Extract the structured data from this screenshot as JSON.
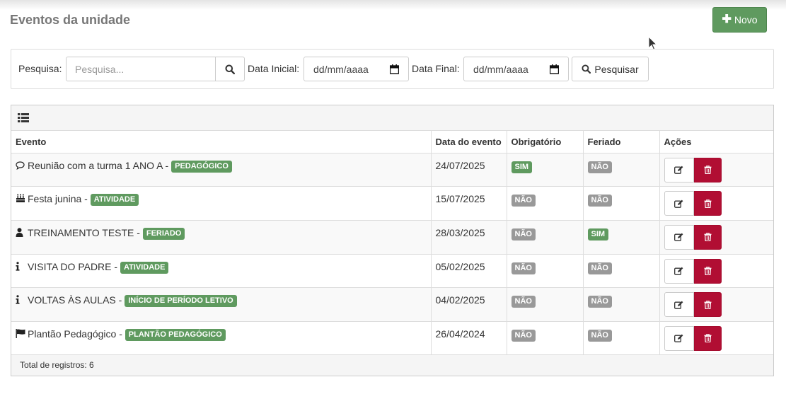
{
  "page": {
    "title": "Eventos da unidade",
    "new_button_label": "Novo"
  },
  "search": {
    "label": "Pesquisa:",
    "placeholder": "Pesquisa...",
    "start_date_label": "Data Inicial:",
    "start_date_placeholder": "dd/mm/aaaa",
    "end_date_label": "Data Final:",
    "end_date_placeholder": "dd/mm/aaaa",
    "submit_label": "Pesquisar"
  },
  "table": {
    "columns": [
      "Evento",
      "Data do evento",
      "Obrigatório",
      "Feriado",
      "Ações"
    ],
    "rows": [
      {
        "icon": "comment-icon",
        "title": "Reunião com a turma 1 ANO A -",
        "category": "PEDAGÓGICO",
        "date": "24/07/2025",
        "mandatory": "SIM",
        "holiday": "NÃO"
      },
      {
        "icon": "birthday-cake-icon",
        "title": "Festa junina -",
        "category": "ATIVIDADE",
        "date": "15/07/2025",
        "mandatory": "NÃO",
        "holiday": "NÃO"
      },
      {
        "icon": "user-icon",
        "title": "TREINAMENTO TESTE -",
        "category": "FERIADO",
        "date": "28/03/2025",
        "mandatory": "NÃO",
        "holiday": "SIM"
      },
      {
        "icon": "info-icon",
        "title": "VISITA DO PADRE -",
        "category": "ATIVIDADE",
        "date": "05/02/2025",
        "mandatory": "NÃO",
        "holiday": "NÃO"
      },
      {
        "icon": "info-icon",
        "title": "VOLTAS ÀS AULAS -",
        "category": "INÍCIO DE PERÍODO LETIVO",
        "date": "04/02/2025",
        "mandatory": "NÃO",
        "holiday": "NÃO"
      },
      {
        "icon": "flag-icon",
        "title": "Plantão Pedagógico -",
        "category": "PLANTÃO PEDAGÓGICO",
        "date": "26/04/2024",
        "mandatory": "NÃO",
        "holiday": "NÃO"
      }
    ],
    "footer": "Total de registros: 6"
  },
  "colors": {
    "success": "#5f9a5f",
    "danger": "#b10e33",
    "muted_badge": "#999999"
  }
}
